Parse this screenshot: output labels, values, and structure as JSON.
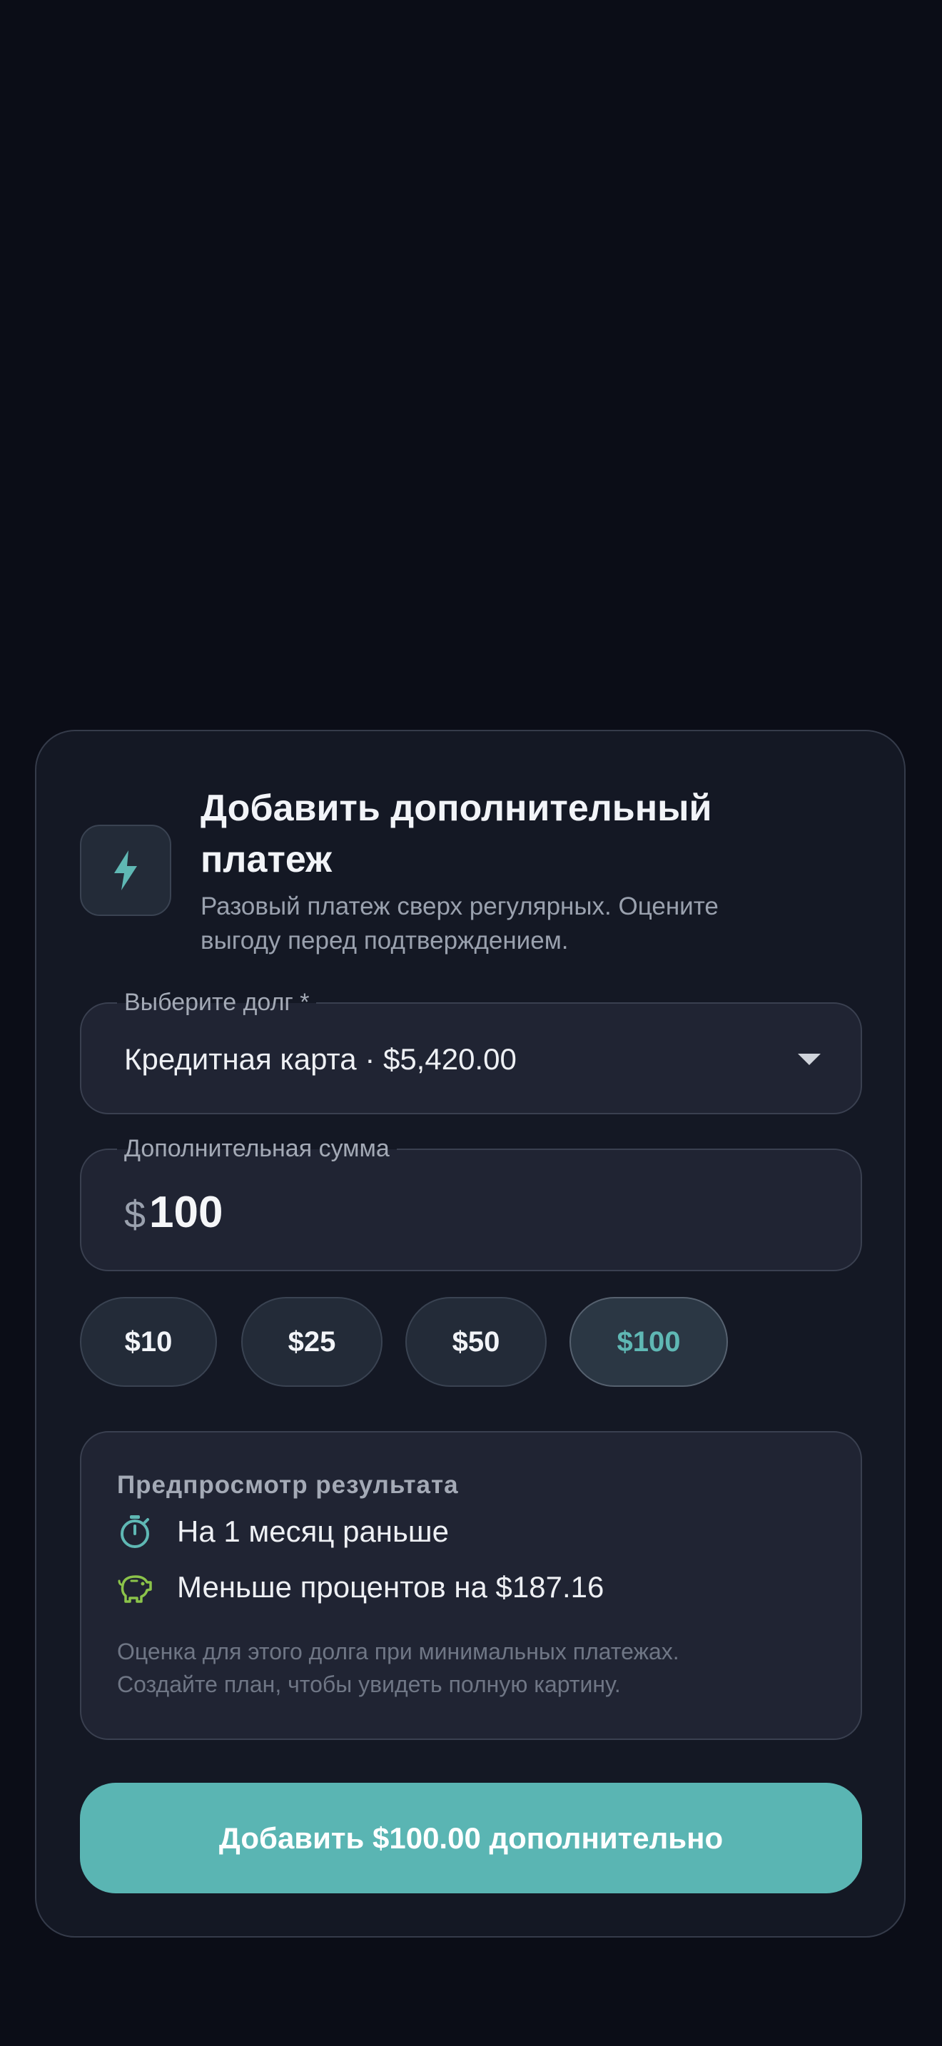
{
  "dialog": {
    "icon": "lightning-bolt-icon",
    "title_line1": "Добавить дополнительный",
    "title_line2": "платеж",
    "subtitle_line1": "Разовый платеж сверх регулярных. Оцените",
    "subtitle_line2": "выгоду перед подтверждением."
  },
  "debt_select": {
    "label": "Выберите долг *",
    "value": "Кредитная карта · $5,420.00",
    "icon": "chevron-down-icon"
  },
  "amount_input": {
    "label": "Дополнительная сумма",
    "prefix": "$",
    "value": "100"
  },
  "quick_amounts": [
    {
      "label": "$10",
      "selected": false
    },
    {
      "label": "$25",
      "selected": false
    },
    {
      "label": "$50",
      "selected": false
    },
    {
      "label": "$100",
      "selected": true
    }
  ],
  "preview": {
    "title": "Предпросмотр результата",
    "rows": [
      {
        "icon": "timer-icon",
        "text": "На 1 месяц раньше"
      },
      {
        "icon": "piggy-bank-icon",
        "text": "Меньше процентов на $187.16"
      }
    ],
    "note_line1": "Оценка для этого долга при минимальных платежах.",
    "note_line2": "Создайте план, чтобы увидеть полную картину."
  },
  "submit_label": "Добавить $100.00 дополнительно",
  "colors": {
    "background": "#0b0d17",
    "sheet": "#141824",
    "accent": "#5ab5b3",
    "piggy": "#8bc34a"
  }
}
